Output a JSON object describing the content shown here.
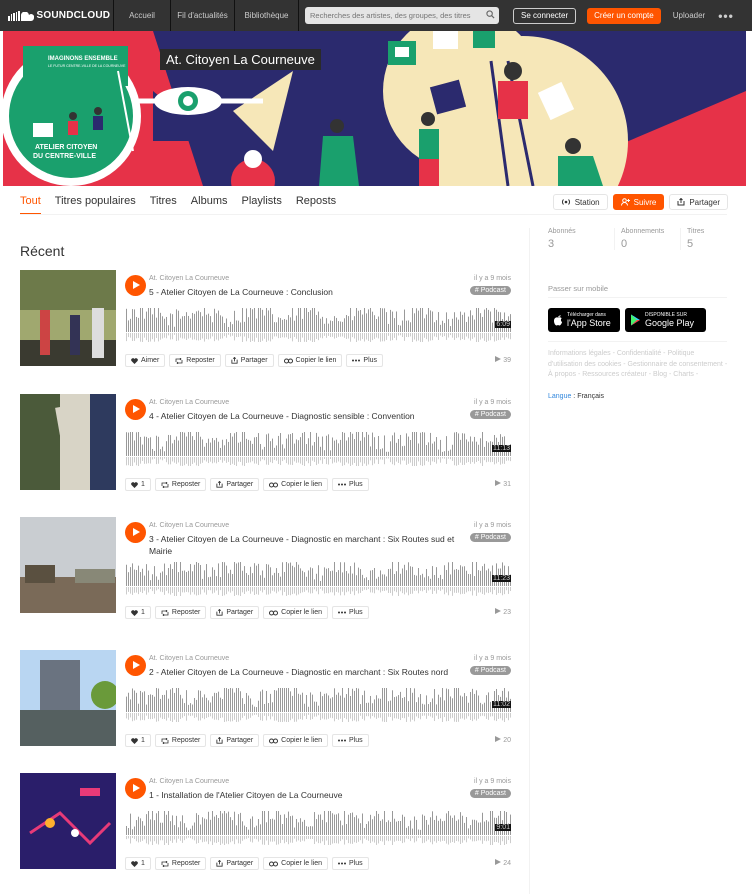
{
  "topbar": {
    "logo": "SOUNDCLOUD",
    "nav": [
      "Accueil",
      "Fil d'actualités",
      "Bibliothèque"
    ],
    "search_placeholder": "Recherches des artistes, des groupes, des titres",
    "login": "Se connecter",
    "create": "Créer un compte",
    "upload": "Uploader",
    "more": "•••"
  },
  "banner": {
    "title": "At. Citoyen La Courneuve",
    "circle_heading": "IMAGINONS ENSEMBLE",
    "circle_sub": "LE FUTUR CENTRE-VILLE DE LA COURNEUVE",
    "circle_footer": [
      "ATELIER CITOYEN",
      "DU CENTRE-VILLE"
    ],
    "colors": {
      "background": "#e63248",
      "dark": "#2b2a6e",
      "green": "#1aa06d",
      "cream": "#f6e7b8"
    }
  },
  "tabs": [
    "Tout",
    "Titres populaires",
    "Titres",
    "Albums",
    "Playlists",
    "Reposts"
  ],
  "tab_actions": {
    "station": "Station",
    "follow": "Suivre",
    "share": "Partager"
  },
  "recent_title": "Récent",
  "tracks": [
    {
      "user": "At. Citoyen La Courneuve",
      "title": "5 - Atelier Citoyen de La Courneuve : Conclusion",
      "date": "il y a 9 mois",
      "tag": "# Podcast",
      "duration": "6:09",
      "likes": "",
      "plays": "39"
    },
    {
      "user": "At. Citoyen La Courneuve",
      "title": "4 - Atelier Citoyen de La Courneuve - Diagnostic sensible : Convention",
      "date": "il y a 9 mois",
      "tag": "# Podcast",
      "duration": "11:13",
      "likes": "1",
      "plays": "31"
    },
    {
      "user": "At. Citoyen La Courneuve",
      "title": "3 - Atelier Citoyen de La Courneuve - Diagnostic en marchant : Six Routes sud et Mairie",
      "date": "il y a 9 mois",
      "tag": "# Podcast",
      "duration": "11:23",
      "likes": "1",
      "plays": "23"
    },
    {
      "user": "At. Citoyen La Courneuve",
      "title": "2 - Atelier Citoyen de La Courneuve - Diagnostic en marchant : Six Routes nord",
      "date": "il y a 9 mois",
      "tag": "# Podcast",
      "duration": "11:02",
      "likes": "1",
      "plays": "20"
    },
    {
      "user": "At. Citoyen La Courneuve",
      "title": "1 - Installation de l'Atelier Citoyen de La Courneuve",
      "date": "il y a 9 mois",
      "tag": "# Podcast",
      "duration": "9:01",
      "likes": "1",
      "plays": "24"
    }
  ],
  "track_actions": {
    "like": "Aimer",
    "repost": "Reposter",
    "share": "Partager",
    "copy": "Copier le lien",
    "more": "Plus"
  },
  "stats": [
    {
      "label": "Abonnés",
      "value": "3"
    },
    {
      "label": "Abonnements",
      "value": "0"
    },
    {
      "label": "Titres",
      "value": "5"
    }
  ],
  "mobile_label": "Passer sur mobile",
  "stores": {
    "apple_small": "Télécharger dans",
    "apple_big": "l'App Store",
    "google_small": "DISPONIBLE SUR",
    "google_big": "Google Play"
  },
  "legal": "Informations légales - Confidentialité - Politique d'utilisation des cookies - Gestionnaire de consentement - À propos - Ressources créateur - Blog - Charts -",
  "language": {
    "label": "Langue",
    "value": "Français"
  }
}
